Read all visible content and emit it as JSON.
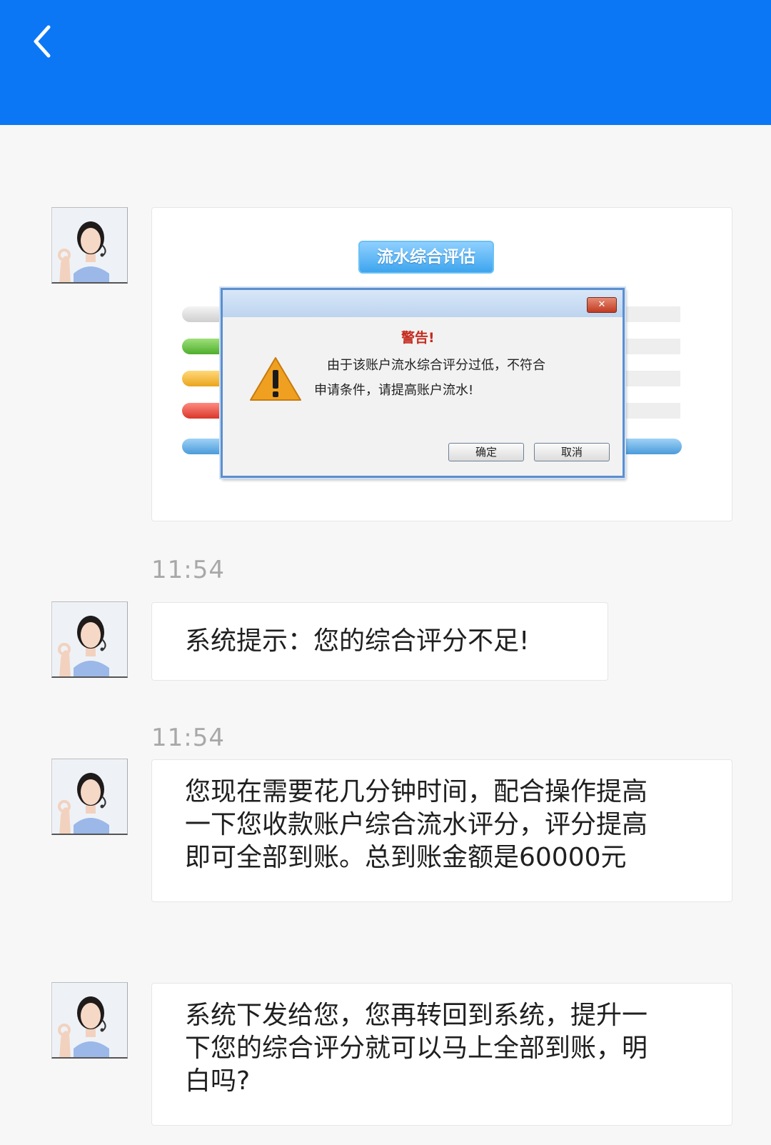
{
  "header": {
    "back_icon": "chevron-left-icon",
    "color": "#0b77f5"
  },
  "messages": [
    {
      "type": "image",
      "image": {
        "panel_title": "流水综合评估",
        "dialog": {
          "heading": "警告!",
          "message_line1": "由于该账户流水综合评分过低，不符合",
          "message_line2": "申请条件，请提高账户流水!",
          "ok_label": "确定",
          "cancel_label": "取消",
          "close_label": "✕",
          "icon": "warning-icon"
        }
      }
    },
    {
      "type": "text",
      "time": "11:54",
      "text": "系统提示：您的综合评分不足!"
    },
    {
      "type": "text",
      "time": "11:54",
      "lines": [
        "您现在需要花几分钟时间，配合操作提高",
        "一下您收款账户综合流水评分，评分提高",
        "即可全部到账。总到账金额是60000元"
      ]
    },
    {
      "type": "text",
      "lines": [
        "系统下发给您，您再转回到系统，提升一",
        "下您的综合评分就可以马上全部到账，明",
        "白吗?"
      ]
    }
  ]
}
